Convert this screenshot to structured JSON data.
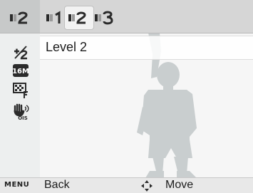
{
  "viewfinder": {
    "subject": "child-silhouette"
  },
  "top_bar": {
    "current_mode_icon": "sharpness-level-2-icon",
    "tabs": [
      {
        "icon": "sharpness-level-1-icon",
        "selected": false
      },
      {
        "icon": "sharpness-level-2-icon",
        "selected": true
      },
      {
        "icon": "sharpness-level-3-icon",
        "selected": false
      }
    ]
  },
  "option": {
    "label": "Level 2"
  },
  "left_strip": {
    "icons": [
      "sharpness-level-2-icon",
      "exposure-compensation-icon",
      "resolution-16m-icon",
      "quality-fine-icon",
      "ois-stabilizer-icon"
    ]
  },
  "bottom_bar": {
    "menu_key": "MENU",
    "back_label": "Back",
    "move_icon": "dpad-icon",
    "move_label": "Move"
  },
  "colors": {
    "bar": "#d6d6d6",
    "strip": "#eceeee",
    "silhouette": "#c9cecf",
    "icon": "#2b2b2b"
  }
}
